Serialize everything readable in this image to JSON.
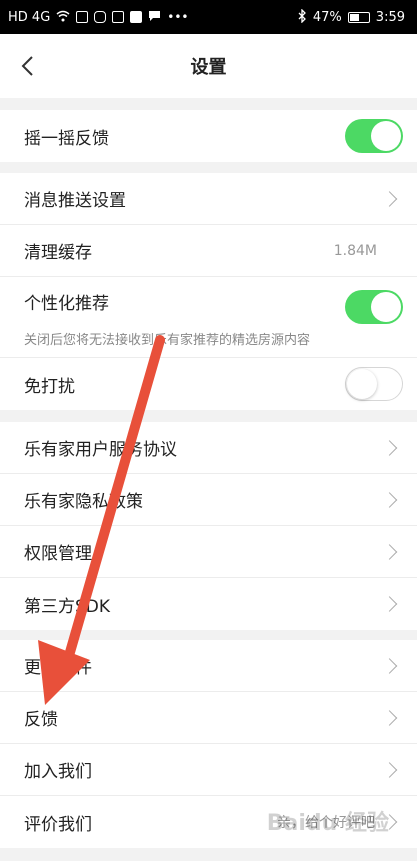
{
  "status_bar": {
    "left_text": "HD 4G",
    "battery_percent": "47%",
    "time": "3:59"
  },
  "header": {
    "title": "设置"
  },
  "group1": {
    "shake_feedback": {
      "label": "摇一摇反馈",
      "toggle": "on"
    }
  },
  "group2": {
    "push_settings": {
      "label": "消息推送设置"
    },
    "clear_cache": {
      "label": "清理缓存",
      "value": "1.84M"
    },
    "personalized": {
      "label": "个性化推荐",
      "sub": "关闭后您将无法接收到乐有家推荐的精选房源内容",
      "toggle": "on"
    },
    "no_disturb": {
      "label": "免打扰",
      "toggle": "off"
    }
  },
  "group3": {
    "user_agreement": {
      "label": "乐有家用户服务协议"
    },
    "privacy": {
      "label": "乐有家隐私政策"
    },
    "permissions": {
      "label": "权限管理"
    },
    "sdk": {
      "label": "第三方SDK"
    }
  },
  "group4": {
    "update": {
      "label": "更新软件"
    },
    "feedback": {
      "label": "反馈"
    },
    "join": {
      "label": "加入我们"
    },
    "rate": {
      "label": "评价我们",
      "value": "亲，给个好评吧"
    }
  },
  "watermark": "Baidu 经验",
  "colors": {
    "toggle_on": "#4cd964",
    "arrow": "#e8503a"
  }
}
